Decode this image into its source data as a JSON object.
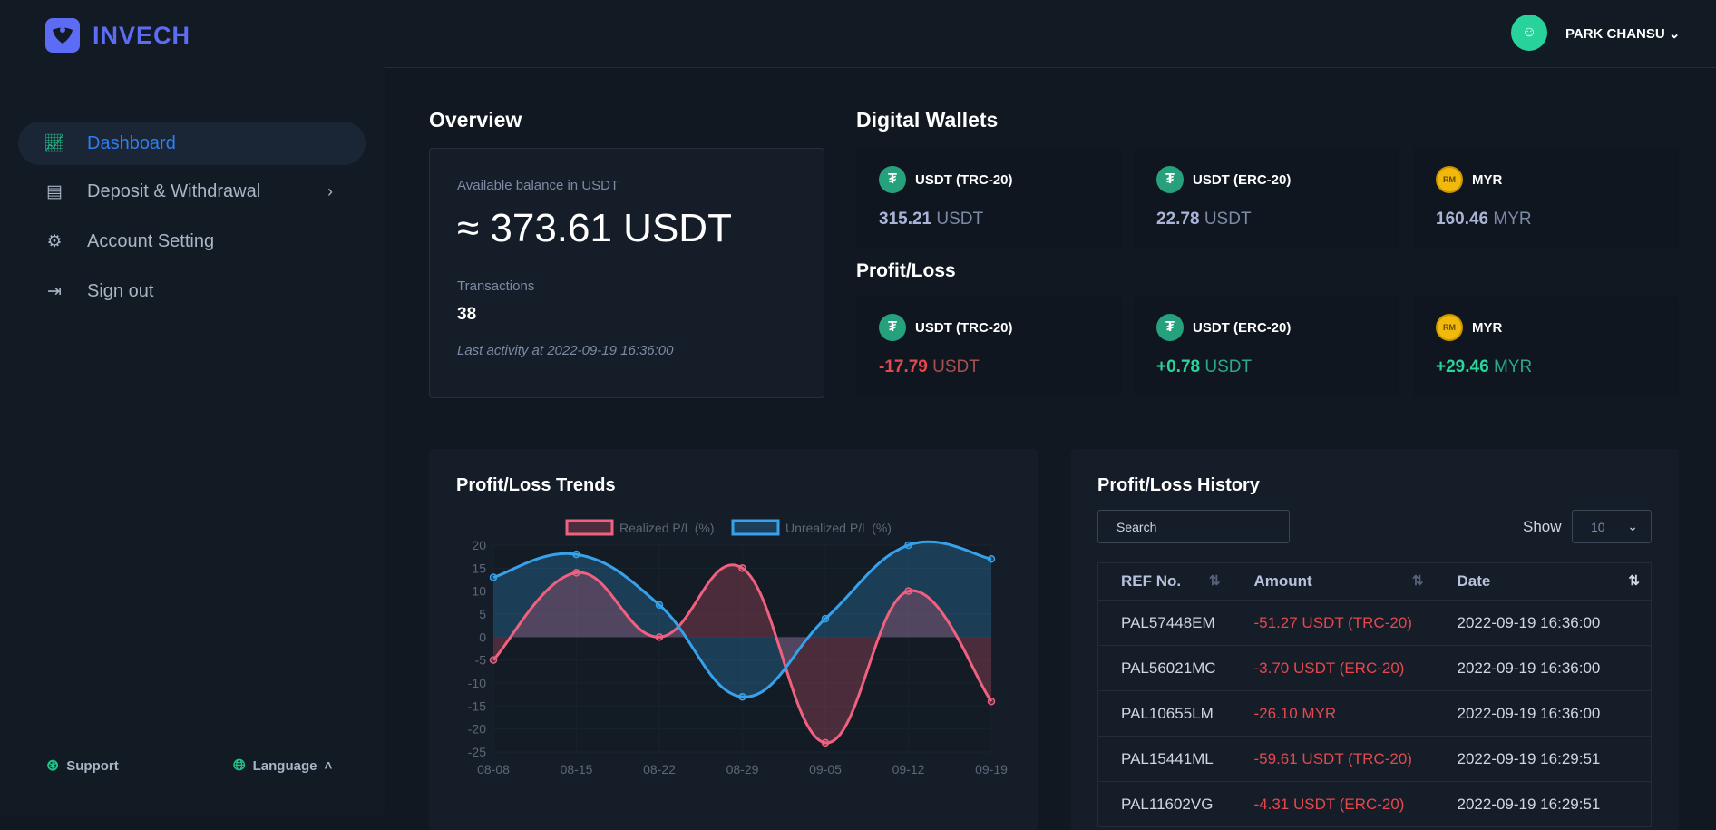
{
  "brand": {
    "name": "INVECH",
    "color": "#5c6cf5"
  },
  "sidebar": {
    "items": [
      {
        "label": "Dashboard",
        "icon": "chart-line-icon",
        "active": true
      },
      {
        "label": "Deposit & Withdrawal",
        "icon": "cash-register-icon",
        "has_submenu": true
      },
      {
        "label": "Account Setting",
        "icon": "gear-icon"
      },
      {
        "label": "Sign out",
        "icon": "sign-out-icon"
      }
    ],
    "support": "Support",
    "language": "Language"
  },
  "header": {
    "user": "PARK CHANSU"
  },
  "overview": {
    "title": "Overview",
    "balance_label": "Available balance in USDT",
    "balance": "≈ 373.61 USDT",
    "tx_label": "Transactions",
    "tx_count": "38",
    "last_activity": "Last activity at 2022-09-19 16:36:00"
  },
  "wallets": {
    "title": "Digital Wallets",
    "items": [
      {
        "name": "USDT (TRC-20)",
        "amount": "315.21",
        "unit": "USDT"
      },
      {
        "name": "USDT (ERC-20)",
        "amount": "22.78",
        "unit": "USDT"
      },
      {
        "name": "MYR",
        "amount": "160.46",
        "unit": "MYR"
      }
    ]
  },
  "profit_loss": {
    "title": "Profit/Loss",
    "items": [
      {
        "name": "USDT (TRC-20)",
        "amount": "-17.79",
        "unit": "USDT"
      },
      {
        "name": "USDT (ERC-20)",
        "amount": "+0.78",
        "unit": "USDT"
      },
      {
        "name": "MYR",
        "amount": "+29.46",
        "unit": "MYR"
      }
    ]
  },
  "trends": {
    "title": "Profit/Loss Trends"
  },
  "chart_data": {
    "type": "line",
    "categories": [
      "08-08",
      "08-15",
      "08-22",
      "08-29",
      "09-05",
      "09-12",
      "09-19"
    ],
    "series": [
      {
        "name": "Realized P/L (%)",
        "values": [
          -5,
          14,
          0,
          15,
          -23,
          10,
          -14
        ],
        "color": "#f0617f"
      },
      {
        "name": "Unrealized P/L (%)",
        "values": [
          13,
          18,
          7,
          -13,
          4,
          20,
          17
        ],
        "color": "#36a2eb"
      }
    ],
    "ylim": [
      -25,
      20
    ],
    "yticks": [
      "20",
      "15",
      "10",
      "5",
      "0",
      "-5",
      "-10",
      "-15",
      "-20",
      "-25"
    ],
    "legend": "top",
    "fill": "origin",
    "smooth": true
  },
  "history": {
    "title": "Profit/Loss History",
    "search_placeholder": "Search",
    "show_label": "Show",
    "show_value": "10",
    "columns": [
      "REF No.",
      "Amount",
      "Date"
    ],
    "rows": [
      [
        "PAL57448EM",
        "-51.27 USDT (TRC-20)",
        "2022-09-19 16:36:00"
      ],
      [
        "PAL56021MC",
        "-3.70 USDT (ERC-20)",
        "2022-09-19 16:36:00"
      ],
      [
        "PAL10655LM",
        "-26.10 MYR",
        "2022-09-19 16:36:00"
      ],
      [
        "PAL15441ML",
        "-59.61 USDT (TRC-20)",
        "2022-09-19 16:29:51"
      ],
      [
        "PAL11602VG",
        "-4.31 USDT (ERC-20)",
        "2022-09-19 16:29:51"
      ]
    ]
  }
}
